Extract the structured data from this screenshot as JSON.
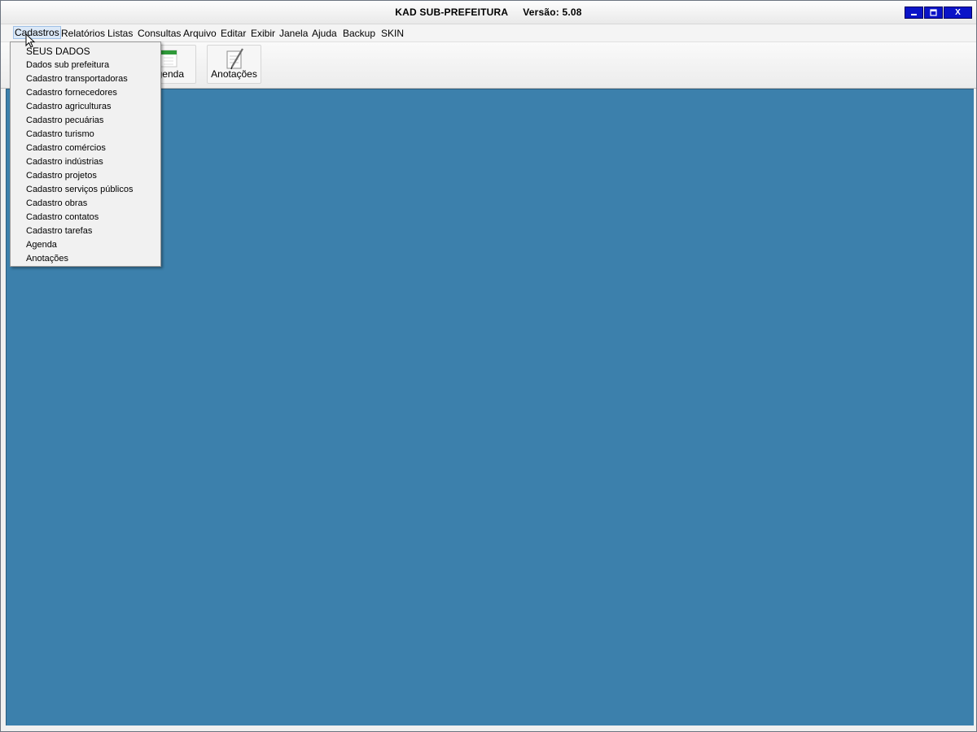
{
  "window": {
    "title": "KAD SUB-PREFEITURA",
    "version": "Versão: 5.08",
    "controls": {
      "minimize": "_",
      "maximize": "□",
      "close": "X"
    }
  },
  "menubar": {
    "items": [
      {
        "label": "Cadastros",
        "icon": ""
      },
      {
        "label": "Relatórios"
      },
      {
        "label": "Listas"
      },
      {
        "label": "Consultas"
      },
      {
        "label": "Arquivo"
      },
      {
        "label": "Editar"
      },
      {
        "label": "Exibir"
      },
      {
        "label": "Janela"
      },
      {
        "label": "Ajuda"
      },
      {
        "label": "Backup"
      },
      {
        "label": "SKIN"
      }
    ]
  },
  "toolbar": {
    "buttons": [
      {
        "label": "Agenda",
        "visible_label": "genda",
        "icon": "calendar-icon"
      },
      {
        "label": "Anotações",
        "icon": "notepad-pen-icon"
      }
    ]
  },
  "dropdown": {
    "items": [
      {
        "label": "SEUS DADOS"
      },
      {
        "label": "Dados sub prefeitura"
      },
      {
        "label": "Cadastro transportadoras"
      },
      {
        "label": "Cadastro fornecedores"
      },
      {
        "label": "Cadastro agriculturas"
      },
      {
        "label": "Cadastro pecuárias"
      },
      {
        "label": "Cadastro turismo"
      },
      {
        "label": "Cadastro comércios"
      },
      {
        "label": "Cadastro indústrias"
      },
      {
        "label": "Cadastro projetos"
      },
      {
        "label": "Cadastro serviços públicos"
      },
      {
        "label": "Cadastro obras"
      },
      {
        "label": "Cadastro contatos"
      },
      {
        "label": "Cadastro tarefas"
      },
      {
        "label": "Agenda"
      },
      {
        "label": "Anotações"
      }
    ]
  },
  "colors": {
    "workspace": "#3c80ac",
    "window_controls": "#0a14c8",
    "menu_highlight": "#dbe8f7"
  }
}
